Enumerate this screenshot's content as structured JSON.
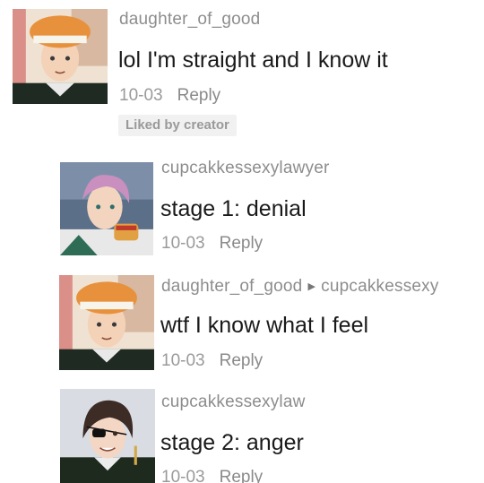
{
  "comments": [
    {
      "username": "daughter_of_good",
      "text": "lol I'm straight and I know it",
      "date": "10-03",
      "reply": "Reply",
      "badge": "Liked by creator"
    },
    {
      "username": "cupcakkessexylawyer",
      "text": "stage 1: denial",
      "date": "10-03",
      "reply": "Reply"
    },
    {
      "username": "daughter_of_good",
      "reply_to": "cupcakkessexy",
      "text": "wtf I know what I feel",
      "date": "10-03",
      "reply": "Reply"
    },
    {
      "username": "cupcakkessexylaw",
      "text": "stage 2: anger",
      "date": "10-03",
      "reply": "Reply"
    }
  ],
  "colors": {
    "username": "#8d8d8d",
    "text": "#1a1a1a",
    "meta": "#9a9a9a",
    "badge_bg": "#f1f1f1"
  },
  "icons": {
    "reply_arrow": "right-triangle-icon"
  }
}
